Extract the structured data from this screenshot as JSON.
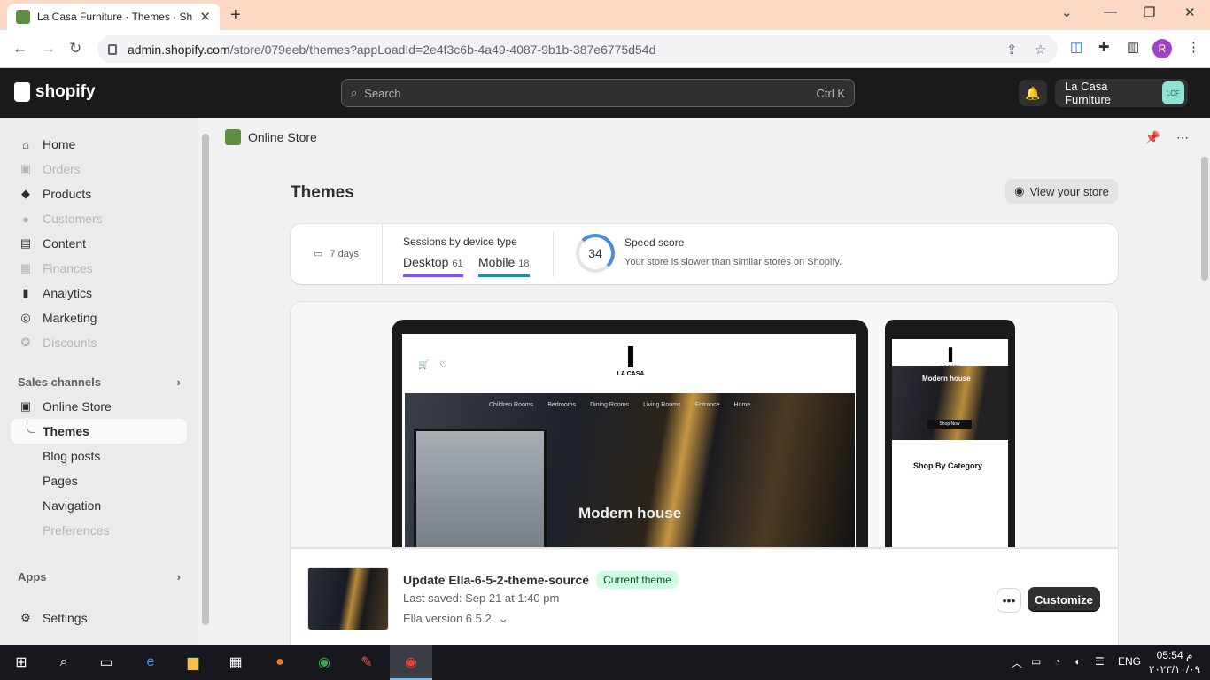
{
  "browser": {
    "tab_title": "La Casa Furniture · Themes · Sho",
    "url_host": "admin.shopify.com",
    "url_path": "/store/079eeb/themes?appLoadId=2e4f3c6b-4a49-4087-9b1b-387e6775d54d",
    "profile_initial": "R"
  },
  "topbar": {
    "logo_text": "shopify",
    "search_placeholder": "Search",
    "search_shortcut": "Ctrl K",
    "store_name": "La Casa Furniture",
    "store_initials": "LCF"
  },
  "sidebar": {
    "items": [
      {
        "label": "Home",
        "icon": "home-icon"
      },
      {
        "label": "Orders",
        "icon": "orders-icon"
      },
      {
        "label": "Products",
        "icon": "tag-icon"
      },
      {
        "label": "Customers",
        "icon": "person-icon"
      },
      {
        "label": "Content",
        "icon": "content-icon"
      },
      {
        "label": "Finances",
        "icon": "bank-icon"
      },
      {
        "label": "Analytics",
        "icon": "bar-chart-icon"
      },
      {
        "label": "Marketing",
        "icon": "target-icon"
      },
      {
        "label": "Discounts",
        "icon": "discount-icon"
      }
    ],
    "sales_channels_label": "Sales channels",
    "online_store_label": "Online Store",
    "sub_items": [
      "Themes",
      "Blog posts",
      "Pages",
      "Navigation",
      "Preferences"
    ],
    "apps_label": "Apps",
    "settings_label": "Settings"
  },
  "appbar": {
    "title": "Online Store"
  },
  "page": {
    "title": "Themes",
    "view_store_label": "View your store"
  },
  "stats": {
    "date_range": "7 days",
    "sessions_label": "Sessions by device type",
    "desktop_label": "Desktop",
    "desktop_count": "61",
    "mobile_label": "Mobile",
    "mobile_count": "18",
    "speed_score": "34",
    "speed_label": "Speed score",
    "speed_desc": "Your store is slower than similar stores on Shopify."
  },
  "preview": {
    "brand": "LA CASA",
    "nav": [
      "Children Rooms",
      "Bedrooms",
      "Dining Rooms",
      "Living Rooms",
      "Entrance",
      "Home"
    ],
    "hero_title": "Modern house",
    "mobile_hero_title": "Modern house",
    "mobile_button": "Shop Now",
    "mobile_category_title": "Shop By Category"
  },
  "theme": {
    "name": "Update Ella-6-5-2-theme-source",
    "badge": "Current theme",
    "last_saved": "Last saved: Sep 21 at 1:40 pm",
    "version": "Ella version 6.5.2",
    "customize_label": "Customize"
  },
  "taskbar": {
    "lang": "ENG",
    "time": "05:54 م",
    "date": "٢٠٢٣/١٠/٠٩"
  }
}
